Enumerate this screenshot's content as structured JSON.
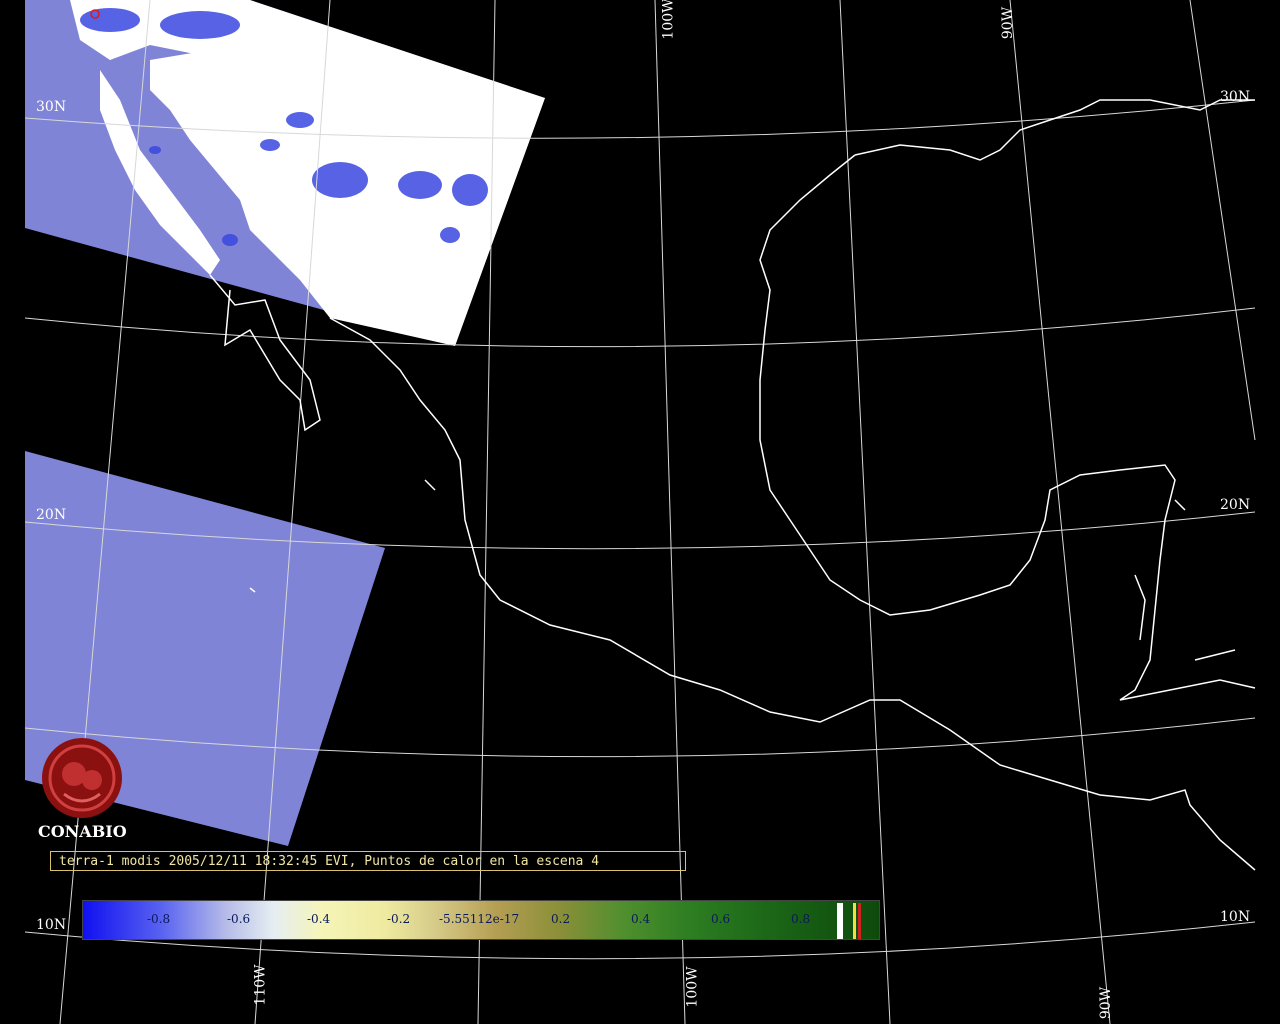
{
  "graticule_labels": {
    "lat": [
      "30N",
      "20N",
      "10N"
    ],
    "lon": [
      "100W",
      "90W",
      "110W"
    ]
  },
  "logo": {
    "name": "CONABIO"
  },
  "caption": "terra-1 modis 2005/12/11 18:32:45 EVI, Puntos de calor en la escena 4",
  "colorbar": {
    "ticks": [
      "-0.8",
      "-0.6",
      "-0.4",
      "-0.2",
      "-5.55112e-17",
      "0.2",
      "0.4",
      "0.6",
      "0.8"
    ],
    "colors": {
      "low": "#1010f0",
      "mid": "#f5f5b8",
      "high": "#0e4a0c"
    }
  },
  "colors": {
    "land_outline": "#ffffff",
    "grid": "#d8d8d8",
    "ocean_swath": "#7f84d6",
    "swath_land": "#ffffff",
    "logo": "#8b1010"
  }
}
